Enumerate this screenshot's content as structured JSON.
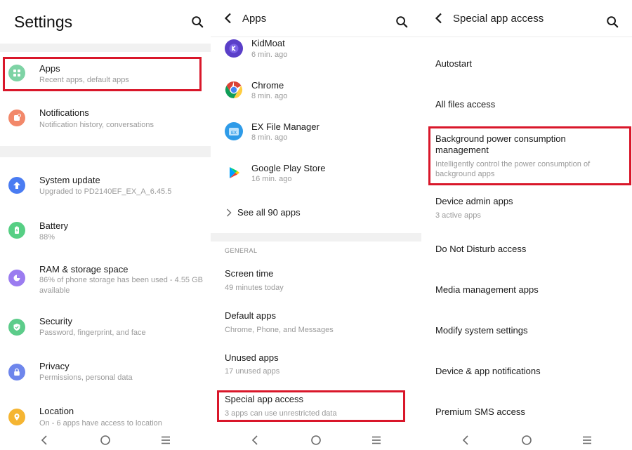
{
  "colors": {
    "highlight": "#d9172a",
    "apps_icon": "#7ed3a5",
    "notifications_icon": "#f2886a",
    "system_update_icon": "#4a7cf2",
    "battery_icon": "#56cf84",
    "ram_icon": "#9b7cf0",
    "security_icon": "#5ccc8a",
    "privacy_icon": "#6e86ec",
    "location_icon": "#f5b532"
  },
  "settings": {
    "title": "Settings",
    "items": [
      {
        "title": "Apps",
        "subtitle": "Recent apps, default apps",
        "icon": "apps-grid-icon"
      },
      {
        "title": "Notifications",
        "subtitle": "Notification history, conversations",
        "icon": "notifications-icon"
      },
      {
        "title": "System update",
        "subtitle": "Upgraded to PD2140EF_EX_A_6.45.5",
        "icon": "system-update-icon"
      },
      {
        "title": "Battery",
        "subtitle": "88%",
        "icon": "battery-icon"
      },
      {
        "title": "RAM & storage space",
        "subtitle": "86% of phone storage has been used - 4.55 GB available",
        "icon": "storage-icon"
      },
      {
        "title": "Security",
        "subtitle": "Password, fingerprint, and face",
        "icon": "shield-icon"
      },
      {
        "title": "Privacy",
        "subtitle": "Permissions, personal data",
        "icon": "lock-icon"
      },
      {
        "title": "Location",
        "subtitle": "On - 6 apps have access to location",
        "icon": "location-pin-icon"
      }
    ]
  },
  "apps_screen": {
    "title": "Apps",
    "recent_apps": [
      {
        "name": "KidMoat",
        "time": "6 min. ago",
        "icon": "kidmoat-icon"
      },
      {
        "name": "Chrome",
        "time": "8 min. ago",
        "icon": "chrome-icon"
      },
      {
        "name": "EX File Manager",
        "time": "8 min. ago",
        "icon": "ex-file-manager-icon"
      },
      {
        "name": "Google Play Store",
        "time": "16 min. ago",
        "icon": "play-store-icon"
      }
    ],
    "see_all": "See all 90 apps",
    "section_label": "GENERAL",
    "general_items": [
      {
        "title": "Screen time",
        "subtitle": "49 minutes today"
      },
      {
        "title": "Default apps",
        "subtitle": "Chrome, Phone, and Messages"
      },
      {
        "title": "Unused apps",
        "subtitle": "17 unused apps"
      },
      {
        "title": "Special app access",
        "subtitle": "3 apps can use unrestricted data"
      }
    ]
  },
  "special_access": {
    "title": "Special app access",
    "items": [
      {
        "title": "Autostart",
        "subtitle": ""
      },
      {
        "title": "All files access",
        "subtitle": ""
      },
      {
        "title": "Background power consumption management",
        "subtitle": "Intelligently control the power consumption of background apps"
      },
      {
        "title": "Device admin apps",
        "subtitle": "3 active apps"
      },
      {
        "title": "Do Not Disturb access",
        "subtitle": ""
      },
      {
        "title": "Media management apps",
        "subtitle": ""
      },
      {
        "title": "Modify system settings",
        "subtitle": ""
      },
      {
        "title": "Device & app notifications",
        "subtitle": ""
      },
      {
        "title": "Premium SMS access",
        "subtitle": ""
      }
    ]
  }
}
